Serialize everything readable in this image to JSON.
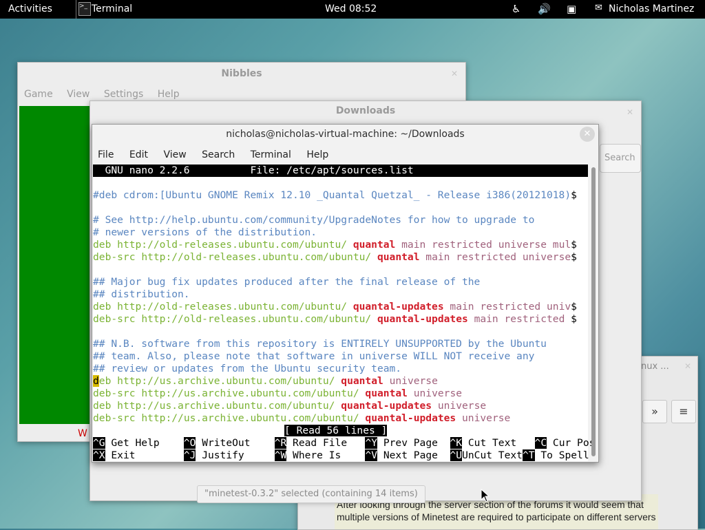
{
  "topbar": {
    "activities": "Activities",
    "app": "Terminal",
    "clock": "Wed 08:52",
    "user": "Nicholas Martinez"
  },
  "nibbles": {
    "title": "Nibbles",
    "menu": [
      "Game",
      "View",
      "Settings",
      "Help"
    ],
    "partial_text": "W"
  },
  "downloads": {
    "title": "Downloads",
    "search_label": "Search",
    "status": "\"minetest-0.3.2\" selected (containing 14 items)"
  },
  "browser": {
    "tab_title": "nux ...",
    "overflow": "»",
    "menu": "≡",
    "body": "After looking through the server section of the forums it would seem that multiple versions of Minetest are required to participate on different servers"
  },
  "terminal": {
    "title": "nicholas@nicholas-virtual-machine: ~/Downloads",
    "menu": [
      "File",
      "Edit",
      "View",
      "Search",
      "Terminal",
      "Help"
    ],
    "nano_version": "  GNU nano 2.2.6",
    "nano_file": "File: /etc/apt/sources.list",
    "lines": {
      "l1": "#deb cdrom:[Ubuntu GNOME Remix 12.10 _Quantal Quetzal_ - Release i386(20121018)",
      "c1": "# See http://help.ubuntu.com/community/UpgradeNotes for how to upgrade to",
      "c2": "# newer versions of the distribution.",
      "c3": "## Major bug fix updates produced after the final release of the",
      "c4": "## distribution.",
      "c5": "## N.B. software from this repository is ENTIRELY UNSUPPORTED by the Ubuntu",
      "c6": "## team. Also, please note that software in universe WILL NOT receive any",
      "c7": "## review or updates from the Ubuntu security team."
    },
    "deb": "deb",
    "deb_src": "deb-src",
    "url_old": "http://old-releases.ubuntu.com/ubuntu/",
    "url_us": "http://us.archive.ubuntu.com/ubuntu/",
    "quantal": "quantal",
    "quantal_updates": "quantal-updates",
    "universe": "universe",
    "comp1": "main restricted universe mul",
    "comp2": "main restricted universe",
    "comp3": "main restricted univ",
    "comp4": "main restricted ",
    "dollar": "$",
    "cursor_char": "d",
    "status": "[ Read 56 lines ]",
    "shortcuts_row1": [
      {
        "key": "^G",
        "label": "Get Help"
      },
      {
        "key": "^O",
        "label": "WriteOut"
      },
      {
        "key": "^R",
        "label": "Read File"
      },
      {
        "key": "^Y",
        "label": "Prev Page"
      },
      {
        "key": "^K",
        "label": "Cut Text"
      },
      {
        "key": "^C",
        "label": "Cur Pos"
      }
    ],
    "shortcuts_row2": [
      {
        "key": "^X",
        "label": "Exit"
      },
      {
        "key": "^J",
        "label": "Justify"
      },
      {
        "key": "^W",
        "label": "Where Is"
      },
      {
        "key": "^V",
        "label": "Next Page"
      },
      {
        "key": "^U",
        "label": "UnCut Text"
      },
      {
        "key": "^T",
        "label": "To Spell"
      }
    ]
  }
}
